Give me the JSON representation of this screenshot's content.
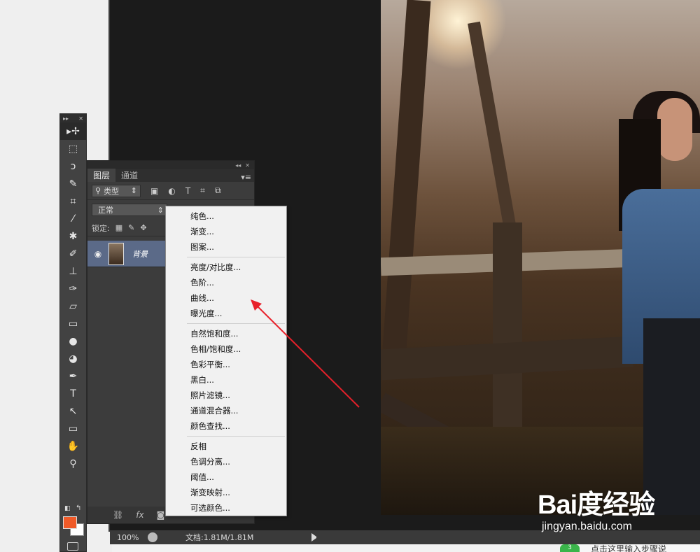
{
  "toolbar": {
    "tools": [
      {
        "name": "move-tool",
        "icon": "▸✢",
        "active": true
      },
      {
        "name": "marquee-tool",
        "icon": "⬚"
      },
      {
        "name": "lasso-tool",
        "icon": "ↄ"
      },
      {
        "name": "quick-selection-tool",
        "icon": "✎"
      },
      {
        "name": "crop-tool",
        "icon": "⌗"
      },
      {
        "name": "eyedropper-tool",
        "icon": "⁄"
      },
      {
        "name": "healing-brush-tool",
        "icon": "✱"
      },
      {
        "name": "brush-tool",
        "icon": "✐"
      },
      {
        "name": "clone-stamp-tool",
        "icon": "⊥"
      },
      {
        "name": "history-brush-tool",
        "icon": "✑"
      },
      {
        "name": "eraser-tool",
        "icon": "▱"
      },
      {
        "name": "gradient-tool",
        "icon": "▭"
      },
      {
        "name": "blur-tool",
        "icon": "●"
      },
      {
        "name": "dodge-tool",
        "icon": "◕"
      },
      {
        "name": "pen-tool",
        "icon": "✒"
      },
      {
        "name": "type-tool",
        "icon": "T"
      },
      {
        "name": "path-selection-tool",
        "icon": "↖"
      },
      {
        "name": "rectangle-tool",
        "icon": "▭"
      },
      {
        "name": "hand-tool",
        "icon": "✋"
      },
      {
        "name": "zoom-tool",
        "icon": "⚲"
      }
    ],
    "foreground_color": "#f05a28",
    "background_color": "#ffffff"
  },
  "layers_panel": {
    "tabs": [
      "图层",
      "通道"
    ],
    "filter_label": "类型",
    "blend_mode": "正常",
    "lock_label": "锁定:",
    "layer_name": "背景"
  },
  "context_menu": {
    "groups": [
      [
        "纯色...",
        "渐变...",
        "图案..."
      ],
      [
        "亮度/对比度...",
        "色阶...",
        "曲线...",
        "曝光度..."
      ],
      [
        "自然饱和度...",
        "色相/饱和度...",
        "色彩平衡...",
        "黑白...",
        "照片滤镜...",
        "通道混合器...",
        "颜色查找..."
      ],
      [
        "反相",
        "色调分离...",
        "阈值...",
        "渐变映射...",
        "可选颜色..."
      ]
    ]
  },
  "status_bar": {
    "zoom": "100%",
    "doc_info": "文档:1.81M/1.81M"
  },
  "watermark": {
    "logo": "Bai度经验",
    "url": "jingyan.baidu.com"
  },
  "step_strip": {
    "number": "3",
    "text": "点击这里输入步骤说"
  },
  "annotation_arrow_color": "#e8202a"
}
